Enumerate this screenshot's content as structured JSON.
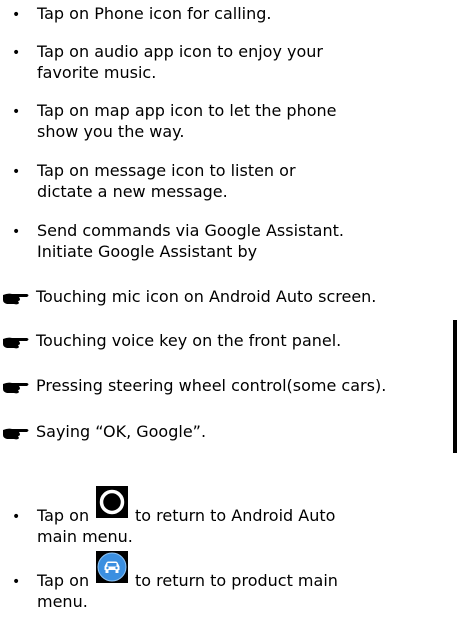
{
  "bullets": [
    {
      "lines": [
        "Tap on Phone icon for calling."
      ]
    },
    {
      "lines": [
        "Tap on audio app icon to enjoy your",
        "favorite music."
      ]
    },
    {
      "lines": [
        "Tap on map app icon to let the phone",
        "show you the way."
      ]
    },
    {
      "lines": [
        "Tap on message icon to listen or",
        "dictate a new message."
      ]
    },
    {
      "lines": [
        "Send commands via Google Assistant.",
        "Initiate Google Assistant by"
      ]
    }
  ],
  "sub_items": [
    "Touching mic icon on Android Auto screen.",
    "Touching voice key on the front panel.",
    "Pressing steering wheel control(some cars).",
    "Saying “OK, Google”."
  ],
  "icon_bullets": [
    {
      "prefix": "Tap on",
      "suffix": "to return to Android Auto",
      "line2": "main menu.",
      "icon": "android-auto-home-icon"
    },
    {
      "prefix": "Tap on",
      "suffix": "to return to product main",
      "line2": "menu.",
      "icon": "car-home-icon"
    }
  ],
  "bullet_glyph": "•",
  "hand_glyph": "pointing-hand-icon",
  "colors": {
    "text": "#000000",
    "car_icon_blue": "#3b8fe0",
    "bar": "#000000"
  }
}
